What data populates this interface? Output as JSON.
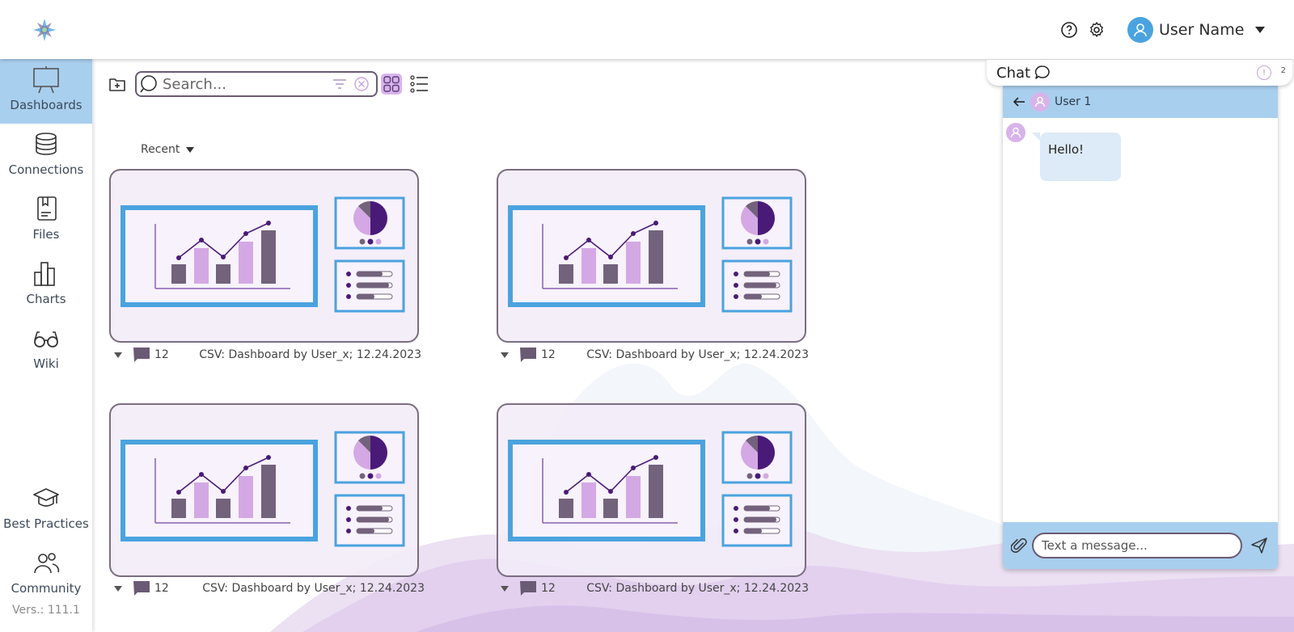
{
  "header": {
    "user_name": "User Name",
    "icons": [
      "help-icon",
      "gear-icon",
      "user-avatar-icon",
      "chevron-down-icon"
    ]
  },
  "sidebar": {
    "items": [
      {
        "label": "Dashboards",
        "icon": "presentation-board-icon",
        "active": true
      },
      {
        "label": "Connections",
        "icon": "database-icon",
        "active": false
      },
      {
        "label": "Files",
        "icon": "book-icon",
        "active": false
      },
      {
        "label": "Charts",
        "icon": "bar-chart-icon",
        "active": false
      },
      {
        "label": "Wiki",
        "icon": "glasses-icon",
        "active": false
      },
      {
        "label": "Best Practices",
        "icon": "graduation-cap-icon",
        "active": false
      },
      {
        "label": "Community",
        "icon": "people-icon",
        "active": false
      }
    ],
    "version": "Vers.: 111.1"
  },
  "toolbar": {
    "search_placeholder": "Search...",
    "view_mode": "grid"
  },
  "sort": {
    "label": "Recent"
  },
  "cards": [
    {
      "comments": "12",
      "description": "CSV: Dashboard by User_x; 12.24.2023"
    },
    {
      "comments": "12",
      "description": "CSV: Dashboard by User_x; 12.24.2023"
    },
    {
      "comments": "12",
      "description": "CSV: Dashboard by User_x; 12.24.2023"
    },
    {
      "comments": "12",
      "description": "CSV: Dashboard by User_x; 12.24.2023"
    }
  ],
  "chat": {
    "title": "Chat",
    "badge_count": "2",
    "badge_symbol": "!",
    "conversation_user": "User 1",
    "messages": [
      {
        "text": "Hello!"
      }
    ],
    "input_placeholder": "Text a message..."
  },
  "colors": {
    "accent_blue": "#4aa3df",
    "active_nav": "#a9cfee",
    "purple_dark": "#4a1a78",
    "purple_light": "#d4a8e4",
    "mauve": "#73627c"
  }
}
